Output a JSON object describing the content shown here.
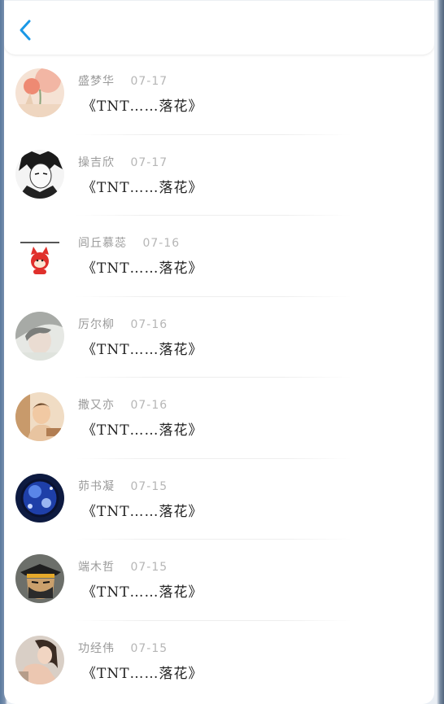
{
  "header": {
    "back_icon": "chevron-left-icon",
    "accent": "#1a98e6"
  },
  "items": [
    {
      "name": "盛梦华",
      "date": "07-17",
      "title": "《TNT……落花》"
    },
    {
      "name": "操吉欣",
      "date": "07-17",
      "title": "《TNT……落花》"
    },
    {
      "name": "闾丘慕蕊",
      "date": "07-16",
      "title": "《TNT……落花》"
    },
    {
      "name": "厉尔柳",
      "date": "07-16",
      "title": "《TNT……落花》"
    },
    {
      "name": "撒又亦",
      "date": "07-16",
      "title": "《TNT……落花》"
    },
    {
      "name": "茆书凝",
      "date": "07-15",
      "title": "《TNT……落花》"
    },
    {
      "name": "端木哲",
      "date": "07-15",
      "title": "《TNT……落花》"
    },
    {
      "name": "功经伟",
      "date": "07-15",
      "title": "《TNT……落花》"
    }
  ]
}
